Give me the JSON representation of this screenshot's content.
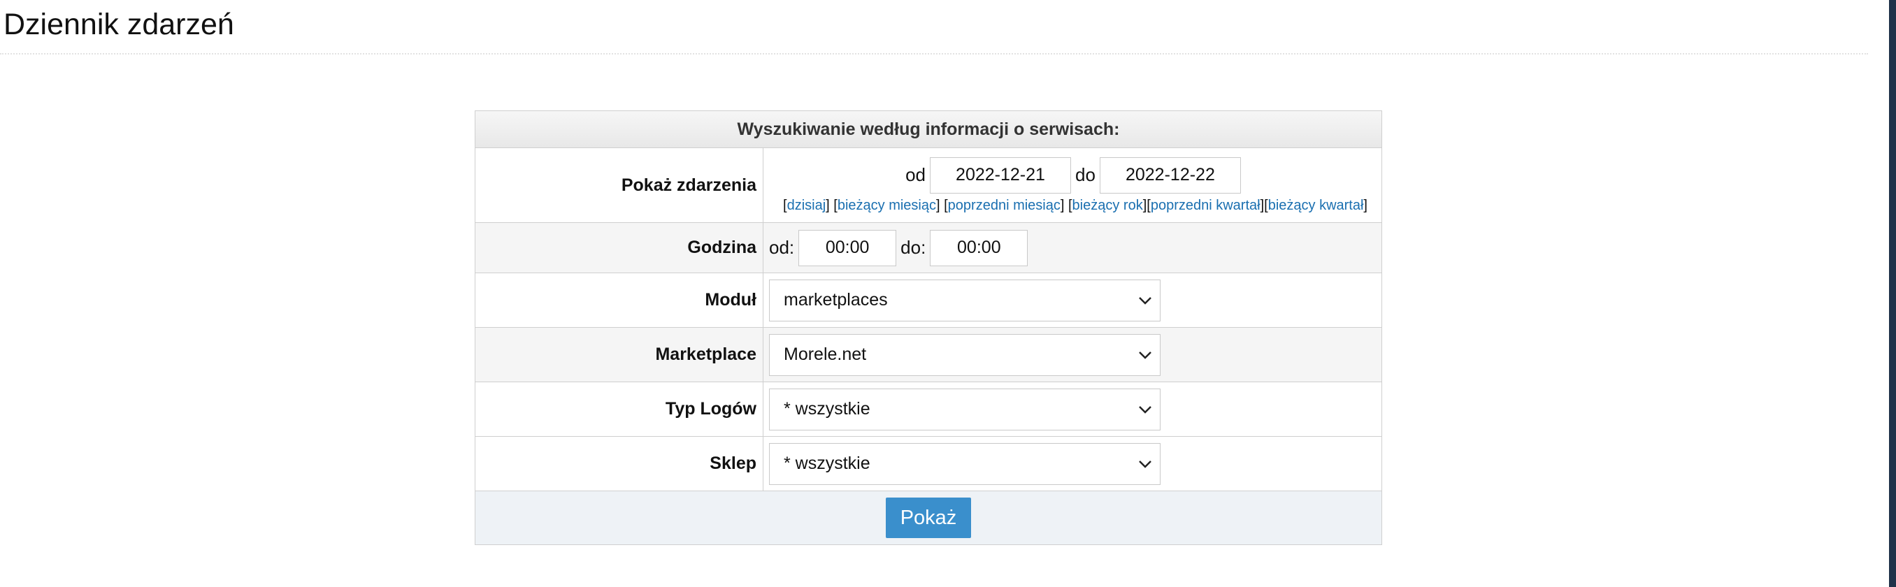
{
  "page": {
    "title": "Dziennik zdarzeń"
  },
  "form": {
    "header": "Wyszukiwanie według informacji o serwisach:",
    "events": {
      "label": "Pokaż zdarzenia",
      "from_prefix": "od",
      "from_value": "2022-12-21",
      "to_prefix": "do",
      "to_value": "2022-12-22",
      "quick_links": [
        "dzisiaj",
        "bieżący miesiąc",
        "poprzedni miesiąc",
        "bieżący rok",
        "poprzedni kwartał",
        "bieżący kwartał"
      ]
    },
    "hour": {
      "label": "Godzina",
      "from_prefix": "od:",
      "from_value": "00:00",
      "to_prefix": "do:",
      "to_value": "00:00"
    },
    "module": {
      "label": "Moduł",
      "selected": "marketplaces"
    },
    "marketplace": {
      "label": "Marketplace",
      "selected": "Morele.net"
    },
    "log_type": {
      "label": "Typ Logów",
      "selected": "* wszystkie"
    },
    "shop": {
      "label": "Sklep",
      "selected": "* wszystkie"
    },
    "submit_label": "Pokaż"
  },
  "icons": {
    "select_arrow": "chevron-down-icon"
  },
  "colors": {
    "link": "#1a6fb0",
    "button": "#3a8fcc",
    "footer_bg": "#eef2f6"
  }
}
